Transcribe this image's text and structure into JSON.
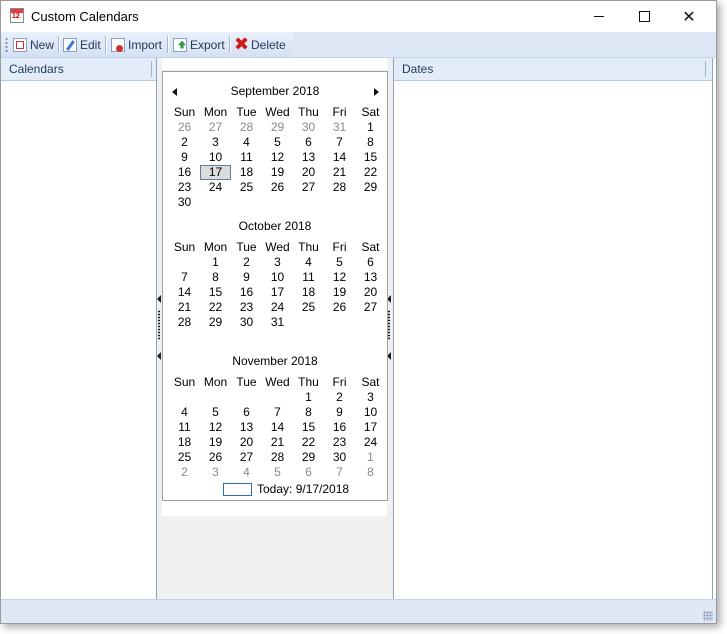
{
  "window": {
    "title": "Custom Calendars",
    "app_icon_text": "12"
  },
  "toolbar": {
    "new_label": "New",
    "edit_label": "Edit",
    "import_label": "Import",
    "export_label": "Export",
    "delete_label": "Delete"
  },
  "left_pane": {
    "header": "Calendars"
  },
  "right_pane": {
    "header": "Dates"
  },
  "calendar": {
    "day_headers": [
      "Sun",
      "Mon",
      "Tue",
      "Wed",
      "Thu",
      "Fri",
      "Sat"
    ],
    "months": [
      {
        "title": "September 2018",
        "weeks": [
          [
            {
              "d": "26",
              "dim": true
            },
            {
              "d": "27",
              "dim": true
            },
            {
              "d": "28",
              "dim": true
            },
            {
              "d": "29",
              "dim": true
            },
            {
              "d": "30",
              "dim": true
            },
            {
              "d": "31",
              "dim": true
            },
            {
              "d": "1"
            }
          ],
          [
            {
              "d": "2"
            },
            {
              "d": "3"
            },
            {
              "d": "4"
            },
            {
              "d": "5"
            },
            {
              "d": "6"
            },
            {
              "d": "7"
            },
            {
              "d": "8"
            }
          ],
          [
            {
              "d": "9"
            },
            {
              "d": "10"
            },
            {
              "d": "11"
            },
            {
              "d": "12"
            },
            {
              "d": "13"
            },
            {
              "d": "14"
            },
            {
              "d": "15"
            }
          ],
          [
            {
              "d": "16"
            },
            {
              "d": "17",
              "selected": true
            },
            {
              "d": "18"
            },
            {
              "d": "19"
            },
            {
              "d": "20"
            },
            {
              "d": "21"
            },
            {
              "d": "22"
            }
          ],
          [
            {
              "d": "23"
            },
            {
              "d": "24"
            },
            {
              "d": "25"
            },
            {
              "d": "26"
            },
            {
              "d": "27"
            },
            {
              "d": "28"
            },
            {
              "d": "29"
            }
          ],
          [
            {
              "d": "30"
            },
            {
              "d": ""
            },
            {
              "d": ""
            },
            {
              "d": ""
            },
            {
              "d": ""
            },
            {
              "d": ""
            },
            {
              "d": ""
            }
          ]
        ]
      },
      {
        "title": "October 2018",
        "weeks": [
          [
            {
              "d": ""
            },
            {
              "d": "1"
            },
            {
              "d": "2"
            },
            {
              "d": "3"
            },
            {
              "d": "4"
            },
            {
              "d": "5"
            },
            {
              "d": "6"
            }
          ],
          [
            {
              "d": "7"
            },
            {
              "d": "8"
            },
            {
              "d": "9"
            },
            {
              "d": "10"
            },
            {
              "d": "11"
            },
            {
              "d": "12"
            },
            {
              "d": "13"
            }
          ],
          [
            {
              "d": "14"
            },
            {
              "d": "15"
            },
            {
              "d": "16"
            },
            {
              "d": "17"
            },
            {
              "d": "18"
            },
            {
              "d": "19"
            },
            {
              "d": "20"
            }
          ],
          [
            {
              "d": "21"
            },
            {
              "d": "22"
            },
            {
              "d": "23"
            },
            {
              "d": "24"
            },
            {
              "d": "25"
            },
            {
              "d": "26"
            },
            {
              "d": "27"
            }
          ],
          [
            {
              "d": "28"
            },
            {
              "d": "29"
            },
            {
              "d": "30"
            },
            {
              "d": "31"
            },
            {
              "d": ""
            },
            {
              "d": ""
            },
            {
              "d": ""
            }
          ]
        ]
      },
      {
        "title": "November 2018",
        "weeks": [
          [
            {
              "d": ""
            },
            {
              "d": ""
            },
            {
              "d": ""
            },
            {
              "d": ""
            },
            {
              "d": "1"
            },
            {
              "d": "2"
            },
            {
              "d": "3"
            }
          ],
          [
            {
              "d": "4"
            },
            {
              "d": "5"
            },
            {
              "d": "6"
            },
            {
              "d": "7"
            },
            {
              "d": "8"
            },
            {
              "d": "9"
            },
            {
              "d": "10"
            }
          ],
          [
            {
              "d": "11"
            },
            {
              "d": "12"
            },
            {
              "d": "13"
            },
            {
              "d": "14"
            },
            {
              "d": "15"
            },
            {
              "d": "16"
            },
            {
              "d": "17"
            }
          ],
          [
            {
              "d": "18"
            },
            {
              "d": "19"
            },
            {
              "d": "20"
            },
            {
              "d": "21"
            },
            {
              "d": "22"
            },
            {
              "d": "23"
            },
            {
              "d": "24"
            }
          ],
          [
            {
              "d": "25"
            },
            {
              "d": "26"
            },
            {
              "d": "27"
            },
            {
              "d": "28"
            },
            {
              "d": "29"
            },
            {
              "d": "30"
            },
            {
              "d": "1",
              "dim": true
            }
          ],
          [
            {
              "d": "2",
              "dim": true
            },
            {
              "d": "3",
              "dim": true
            },
            {
              "d": "4",
              "dim": true
            },
            {
              "d": "5",
              "dim": true
            },
            {
              "d": "6",
              "dim": true
            },
            {
              "d": "7",
              "dim": true
            },
            {
              "d": "8",
              "dim": true
            }
          ]
        ]
      }
    ],
    "today_label": "Today: 9/17/2018"
  },
  "colors": {
    "accent": "#2f6db3",
    "toolbar_bg": "#dce6f4",
    "pane_header_bg": "#e3edf9",
    "delete_red": "#d01818"
  }
}
